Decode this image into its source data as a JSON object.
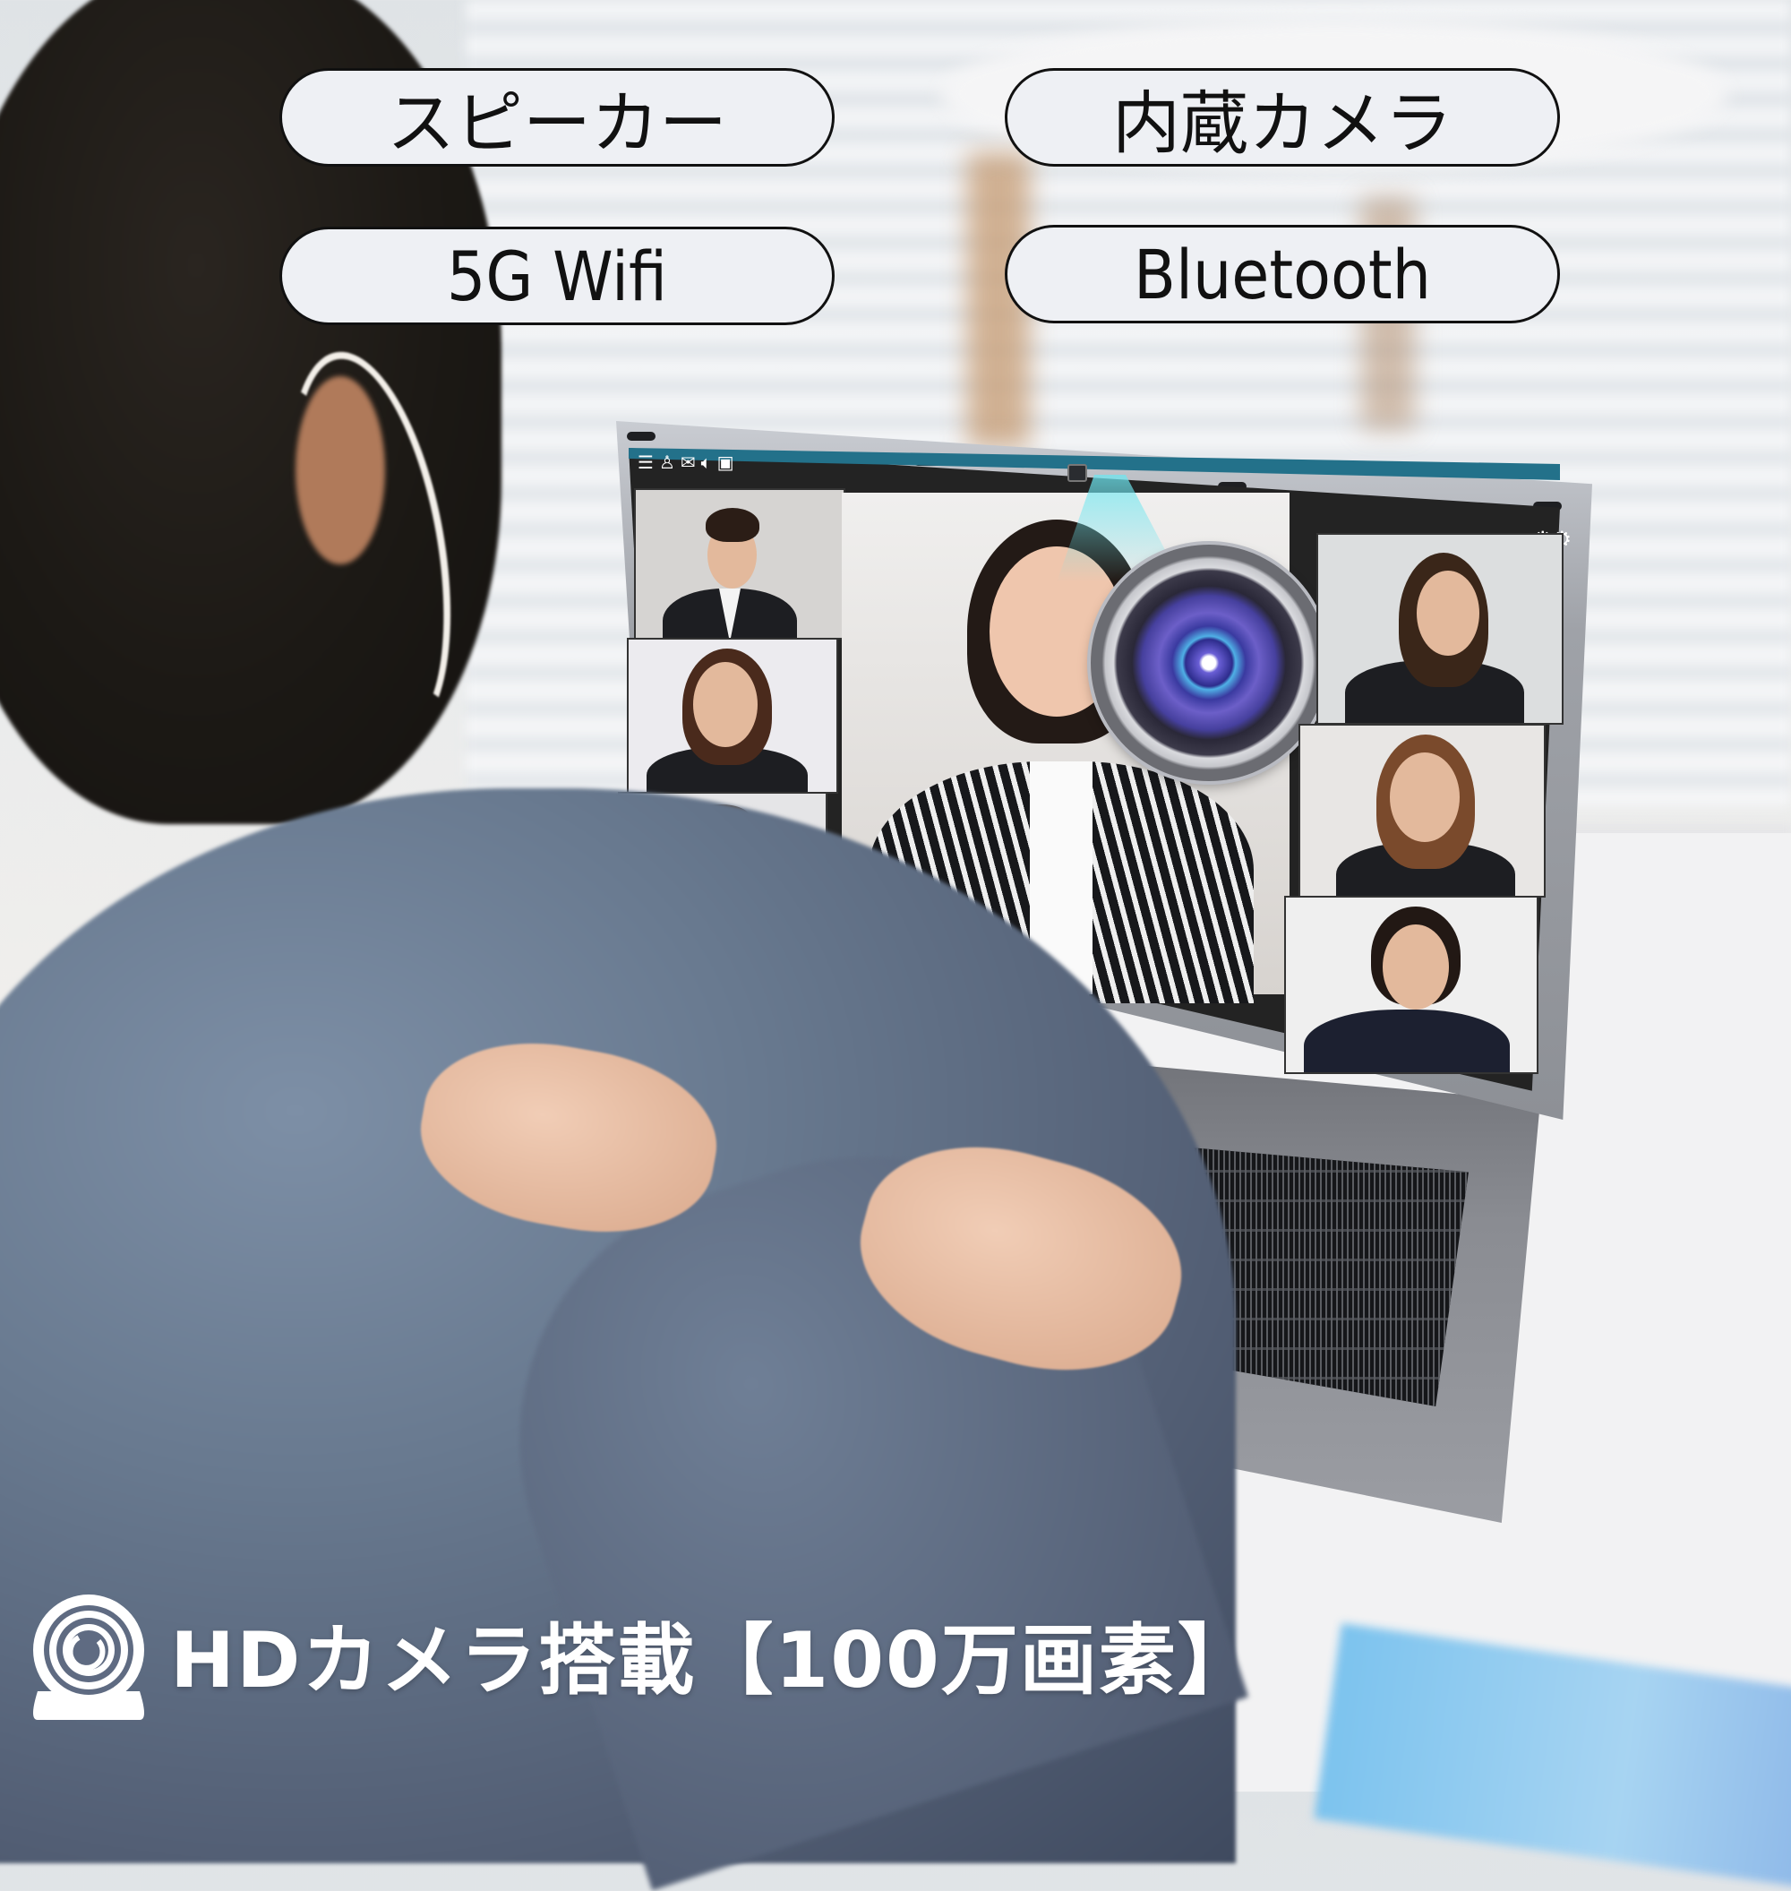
{
  "features": [
    {
      "label": "スピーカー",
      "icon": "speaker"
    },
    {
      "label": "内蔵カメラ",
      "icon": "camera"
    },
    {
      "label": "5G Wifi",
      "icon": "wifi"
    },
    {
      "label": "Bluetooth",
      "icon": "bluetooth"
    }
  ],
  "caption": {
    "text": "HDカメラ搭載【100万画素】",
    "icon": "webcam-icon"
  },
  "video_call_app": {
    "toolbar_icons": [
      "menu-icon",
      "contact-icon",
      "mail-icon",
      "volume-icon",
      "share-icon"
    ],
    "settings_icon": "gears-icon",
    "participants_count": 7,
    "controls": [
      {
        "name": "add-participant",
        "glyph": "+",
        "color": "#8f8f8f"
      },
      {
        "name": "video",
        "glyph": "▶",
        "color": "#1fbf2a"
      },
      {
        "name": "hang-up",
        "glyph": "☎",
        "color": "#e3201f"
      }
    ],
    "bar_color": "#23718a"
  },
  "colors": {
    "pill_bg": "#eef0f4",
    "pill_border": "#111111",
    "caption_text": "#ffffff"
  }
}
